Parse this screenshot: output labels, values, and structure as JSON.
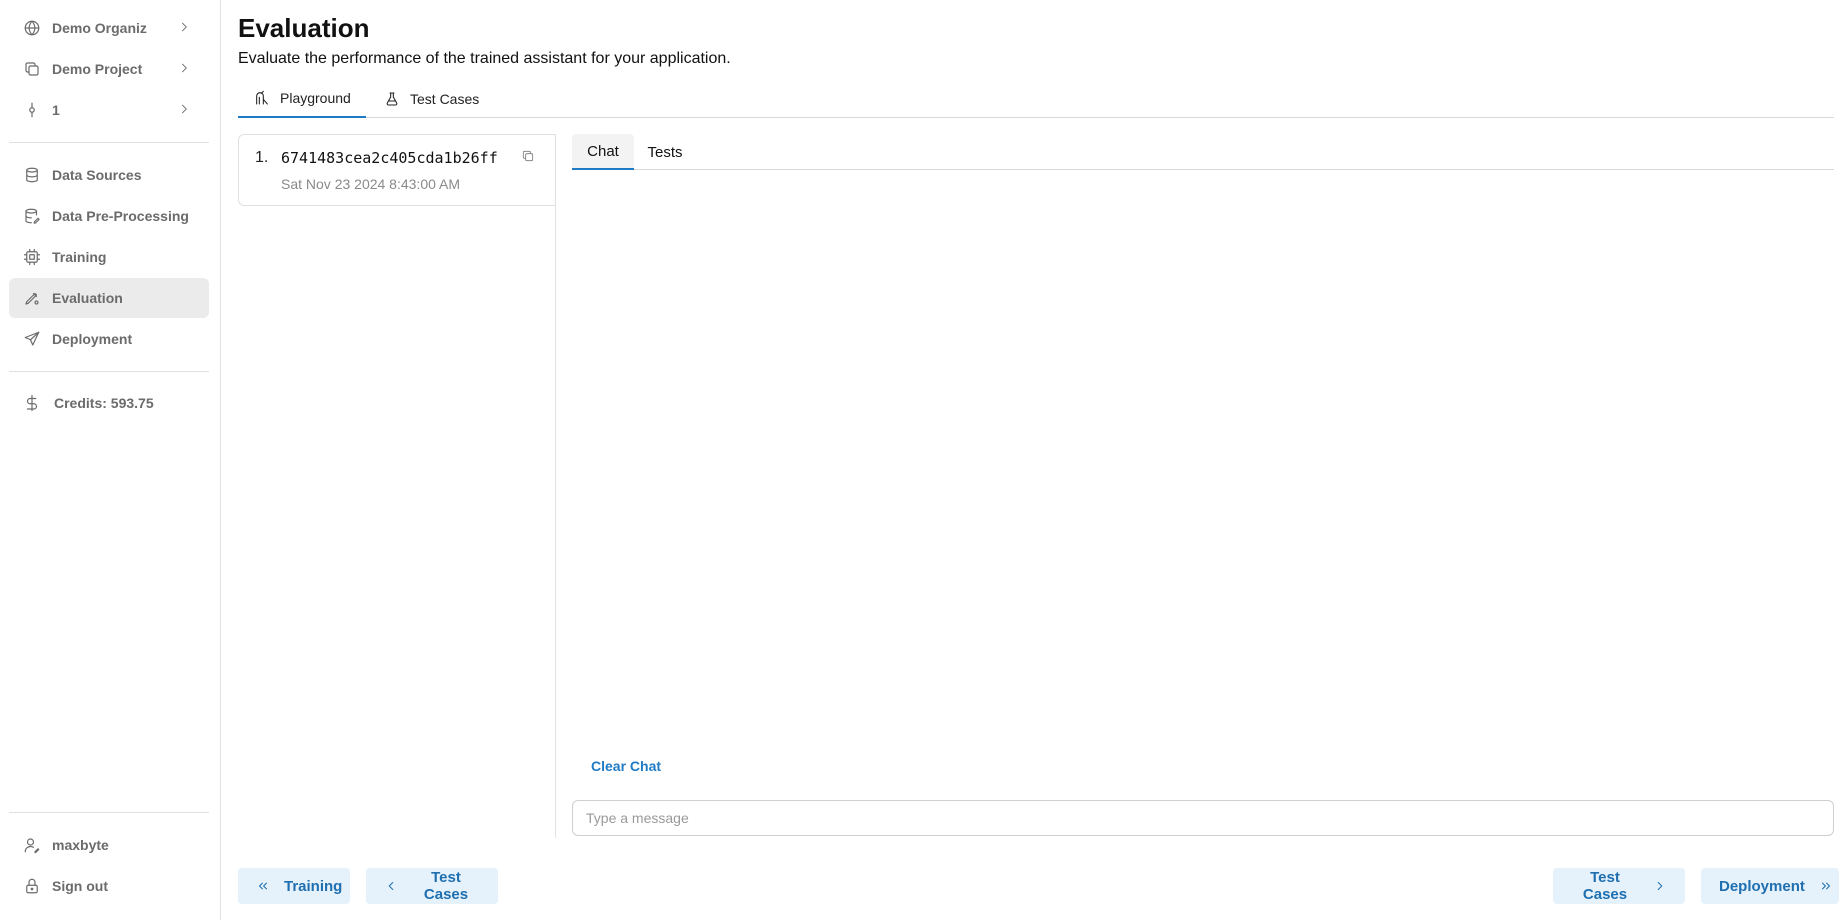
{
  "sidebar": {
    "org": {
      "label": "Demo Organiz",
      "icon": "globe-icon"
    },
    "project": {
      "label": "Demo Project",
      "icon": "copy-stack-icon"
    },
    "version": {
      "label": "1",
      "icon": "commit-icon"
    },
    "items": [
      {
        "label": "Data Sources",
        "icon": "database-icon"
      },
      {
        "label": "Data Pre-Processing",
        "icon": "database-edit-icon"
      },
      {
        "label": "Training",
        "icon": "cpu-icon"
      },
      {
        "label": "Evaluation",
        "icon": "pen-tool-icon"
      },
      {
        "label": "Deployment",
        "icon": "send-icon"
      }
    ],
    "credits": "Credits: 593.75",
    "user": "maxbyte",
    "sign_out": "Sign out"
  },
  "page": {
    "title": "Evaluation",
    "subtitle": "Evaluate the performance of the trained assistant for your application."
  },
  "tabs": [
    {
      "label": "Playground",
      "icon": "playground-icon",
      "active": true
    },
    {
      "label": "Test Cases",
      "icon": "flask-icon",
      "active": false
    }
  ],
  "runs": [
    {
      "index": "1.",
      "id": "6741483cea2c405cda1b26ff",
      "date": "Sat Nov 23 2024 8:43:00 AM"
    }
  ],
  "chat": {
    "tabs": [
      "Chat",
      "Tests"
    ],
    "clear_label": "Clear Chat",
    "placeholder": "Type a message",
    "value": ""
  },
  "footer": {
    "prev_far": "Training",
    "prev": "Test Cases",
    "next": "Test Cases",
    "next_far": "Deployment"
  },
  "colors": {
    "accent": "#1f7bc5",
    "active_bg": "#ebebeb",
    "button_bg": "#e5f1fb"
  }
}
